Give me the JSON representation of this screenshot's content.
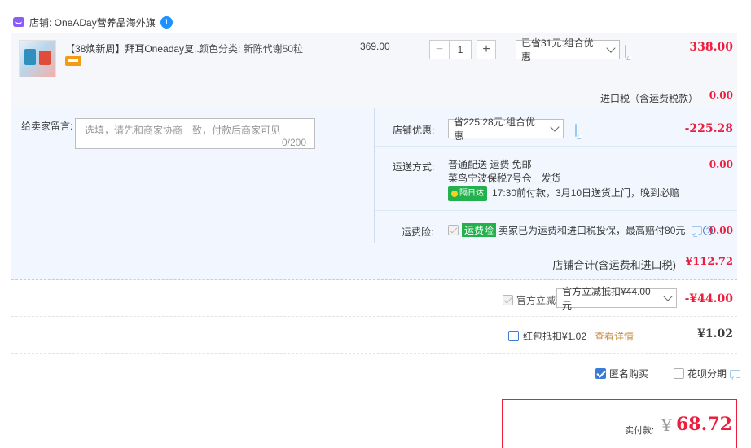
{
  "shop": {
    "label": "店铺: OneADay营养品海外旗",
    "ww_badge": "1"
  },
  "item": {
    "title": "【38焕新周】拜耳Oneaday复...",
    "sku": "颜色分类: 新陈代谢50粒",
    "unit_price": "369.00",
    "qty_minus": "−",
    "qty_value": "1",
    "qty_plus": "+",
    "promo_select": "已省31元:组合优惠",
    "subtotal": "338.00"
  },
  "tax": {
    "label": "进口税（含运费税款）",
    "value": "0.00"
  },
  "message": {
    "label": "给卖家留言:",
    "placeholder": "选填，请先和商家协商一致，付款后商家可见",
    "count": "0/200"
  },
  "shop_discount": {
    "label": "店铺优惠:",
    "select": "省225.28元:组合优惠",
    "value": "-225.28"
  },
  "shipping": {
    "label": "运送方式:",
    "line1": "普通配送 运费 免邮",
    "line2": "菜鸟宁波保税7号仓　发货",
    "badge": "隔日达",
    "line3": "17:30前付款，3月10日送货上门，晚到必赔",
    "value": "0.00"
  },
  "insurance": {
    "label": "运费险:",
    "badge": "运费险",
    "text": "卖家已为运费和进口税投保，最高赔付80元",
    "value": "0.00"
  },
  "shop_total": {
    "label": "店铺合计(含运费和进口税)",
    "value": "¥112.72"
  },
  "official_discount": {
    "label": "官方立减",
    "select": "官方立减抵扣¥44.00元",
    "value": "-¥44.00"
  },
  "red_packet": {
    "label": "红包抵扣¥1.02",
    "link": "查看详情",
    "value": "¥1.02"
  },
  "options": {
    "anonymous": "匿名购买",
    "huabei": "花呗分期"
  },
  "final": {
    "label": "实付款:",
    "currency": "¥",
    "value": "68.72"
  },
  "colors": {
    "accent_red": "#ee1d3c",
    "blue": "#3a7bd5",
    "green": "#22b14c"
  }
}
